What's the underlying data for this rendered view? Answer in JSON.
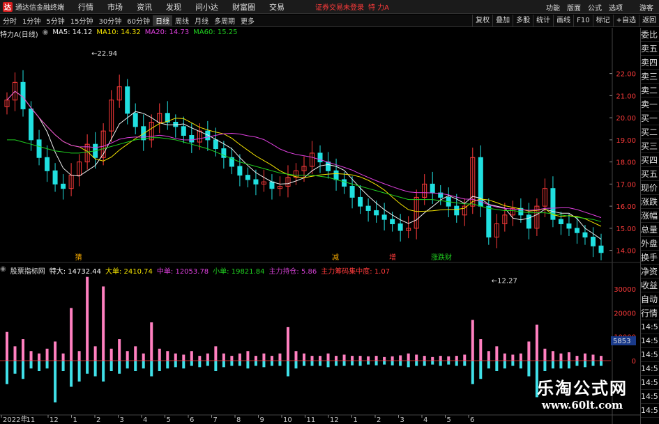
{
  "app": {
    "title": "通达信金融终端",
    "logo": "达"
  },
  "menu": [
    "行情",
    "市场",
    "资讯",
    "发现",
    "问小达",
    "财富圈",
    "交易"
  ],
  "login_status": "证券交易未登录",
  "stock_title": "特 力A",
  "right_menu": [
    "功能",
    "版面",
    "公式",
    "选项",
    "游客"
  ],
  "toolbar": {
    "periods": [
      "分时",
      "1分钟",
      "5分钟",
      "15分钟",
      "30分钟",
      "60分钟",
      "日线",
      "周线",
      "月线",
      "多周期",
      "更多"
    ],
    "active": "日线",
    "right": [
      "复权",
      "叠加",
      "多股",
      "统计",
      "画线",
      "F10",
      "标记",
      "+自选",
      "返回"
    ]
  },
  "info": {
    "name": "特力A",
    "period": "(日线)",
    "ma5": "MA5: 14.12",
    "ma10": "MA10: 14.32",
    "ma20": "MA20: 14.73",
    "ma60": "MA60: 15.25"
  },
  "vol_info": {
    "name": "股票指标网",
    "tedai": "特大: 14732.44",
    "dadan": "大单: 2410.74",
    "zhongdan": "中单: 12053.78",
    "xiaodan": "小单: 19821.84",
    "zhuli": "主力持仓: 5.86",
    "chouma": "主力筹码集中度: 1.07"
  },
  "right_panel": [
    "委比",
    "卖五",
    "卖四",
    "卖三",
    "卖二",
    "卖一",
    "买一",
    "买二",
    "买三",
    "买四",
    "买五",
    "现价",
    "涨跌",
    "涨幅",
    "总量",
    "外盘",
    "换手",
    "净资",
    "收益",
    "自动",
    "行情",
    "14:5",
    "14:5",
    "14:5",
    "14:5",
    "14:5",
    "14:5",
    "14:5"
  ],
  "colors": {
    "up": "#ff3b3b",
    "down": "#20e0e0",
    "ma5": "#f0f0f0",
    "ma10": "#f5e400",
    "ma20": "#e040e0",
    "ma60": "#20d020",
    "pink": "#ff80c0",
    "cyan": "#40e0e8"
  },
  "markers": [
    "猜",
    "减",
    "增",
    "涨跌财"
  ],
  "price_labels": {
    "high": "22.94",
    "low": "12.27"
  },
  "chart_data": {
    "type": "line",
    "price_axis": [
      "22.00",
      "21.00",
      "20.00",
      "19.00",
      "18.00",
      "17.00",
      "16.00",
      "15.00",
      "14.00"
    ],
    "price_axis_values": [
      22,
      21,
      20,
      19,
      18,
      17,
      16,
      15,
      14
    ],
    "ylim": [
      13.2,
      23.5
    ],
    "volume_axis": [
      "30000",
      "20000",
      "10000",
      "0"
    ],
    "volume_axis_values": [
      30000,
      20000,
      10000,
      0
    ],
    "volume_current": "5853",
    "x_labels": [
      "2022年",
      "11",
      "12",
      "1",
      "2",
      "3",
      "4",
      "5",
      "6",
      "7",
      "8",
      "9",
      "10",
      "11",
      "12",
      "1",
      "2",
      "3",
      "4",
      "5",
      "6"
    ],
    "close": [
      20.8,
      21.6,
      20.4,
      19.0,
      18.2,
      17.6,
      17.0,
      16.8,
      17.4,
      18.0,
      18.8,
      18.2,
      19.4,
      20.8,
      21.4,
      20.2,
      19.6,
      19.0,
      19.8,
      20.2,
      19.8,
      19.6,
      19.2,
      18.9,
      19.4,
      19.0,
      18.6,
      18.2,
      17.8,
      17.4,
      17.2,
      17.0,
      17.1,
      16.8,
      16.9,
      17.3,
      17.6,
      17.8,
      18.4,
      18.0,
      17.6,
      17.2,
      16.9,
      16.4,
      16.0,
      15.8,
      15.6,
      15.4,
      15.2,
      14.9,
      15.0,
      16.4,
      17.0,
      16.6,
      16.4,
      16.0,
      15.6,
      16.0,
      18.2,
      16.0,
      14.6,
      15.2,
      15.6,
      15.9,
      15.6,
      15.0,
      16.0,
      16.8,
      15.4,
      15.2,
      15.0,
      14.8,
      14.6,
      14.2,
      13.9
    ],
    "ma60": [
      19.0,
      19.0,
      18.9,
      18.8,
      18.7,
      18.6,
      18.5,
      18.45,
      18.4,
      18.4,
      18.45,
      18.5,
      18.6,
      18.7,
      18.8,
      18.9,
      19.0,
      19.05,
      19.1,
      19.1,
      19.05,
      19.0,
      18.9,
      18.8,
      18.7,
      18.6,
      18.45,
      18.3,
      18.15,
      18.0,
      17.9,
      17.8,
      17.7,
      17.6,
      17.5,
      17.45,
      17.4,
      17.4,
      17.4,
      17.35,
      17.3,
      17.2,
      17.1,
      17.0,
      16.9,
      16.8,
      16.7,
      16.6,
      16.5,
      16.4,
      16.3,
      16.3,
      16.3,
      16.3,
      16.25,
      16.2,
      16.15,
      16.1,
      16.1,
      16.0,
      15.9,
      15.85,
      15.8,
      15.8,
      15.75,
      15.7,
      15.7,
      15.7,
      15.65,
      15.6,
      15.55,
      15.5,
      15.45,
      15.4,
      15.3
    ],
    "volume": [
      12000,
      6000,
      9000,
      4000,
      3000,
      5000,
      8000,
      3000,
      22000,
      4000,
      35000,
      6000,
      31000,
      5000,
      9000,
      4000,
      6000,
      3000,
      16000,
      5000,
      4000,
      3000,
      2500,
      4000,
      2000,
      3000,
      6000,
      3000,
      2000,
      3000,
      4000,
      2000,
      3000,
      2000,
      3000,
      14000,
      4000,
      3000,
      2000,
      2000,
      3000,
      2000,
      2500,
      2000,
      2000,
      1800,
      2000,
      1500,
      1800,
      2200,
      3000,
      2500,
      2000,
      1500,
      2000,
      1800,
      2000,
      2500,
      17000,
      9000,
      4000,
      6000,
      3000,
      2500,
      3000,
      8000,
      15000,
      5000,
      4000,
      3000,
      3500,
      2000,
      3000,
      2500,
      2000
    ],
    "sell_volume": [
      9000,
      5000,
      7000,
      3000,
      4000,
      3000,
      16000,
      4000,
      10000,
      8000,
      5000,
      6000,
      8000,
      4000,
      5000,
      3000,
      4000,
      3000,
      6000,
      4000,
      3000,
      2500,
      3000,
      2000,
      2500,
      2000,
      4000,
      2500,
      2000,
      2000,
      3000,
      2000,
      2500,
      2000,
      2000,
      6000,
      3000,
      2000,
      2000,
      2000,
      2500,
      2000,
      2000,
      1800,
      2000,
      1500,
      1800,
      1500,
      1800,
      2000,
      2500,
      2000,
      2000,
      1500,
      2000,
      1500,
      2000,
      2000,
      9000,
      7000,
      3000,
      4000,
      3000,
      2000,
      3000,
      6000,
      14000,
      4000,
      3000,
      3000,
      3000,
      2000,
      2500,
      2000,
      2000
    ]
  }
}
